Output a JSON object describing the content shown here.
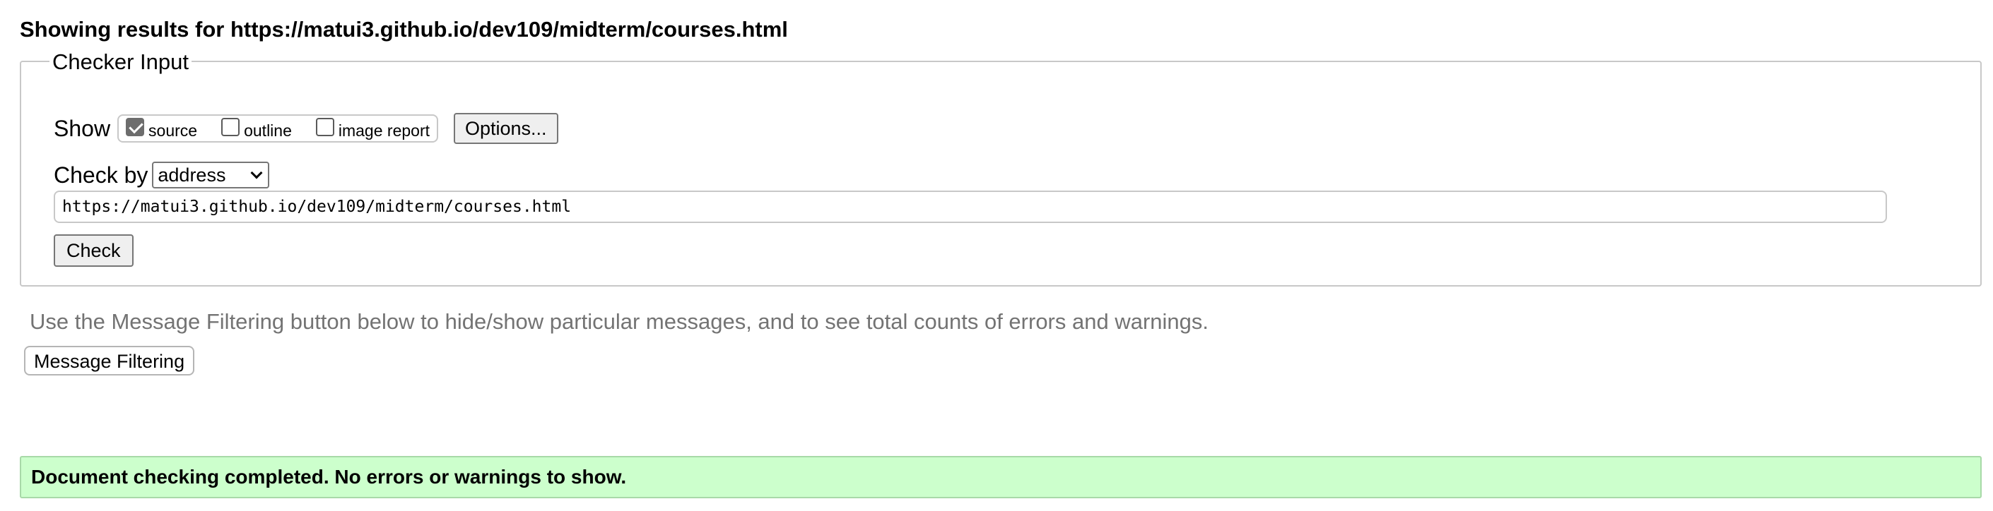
{
  "heading": "Showing results for https://matui3.github.io/dev109/midterm/courses.html",
  "checker": {
    "legend": "Checker Input",
    "show_label": "Show",
    "options": [
      {
        "label": "source",
        "checked": true
      },
      {
        "label": "outline",
        "checked": false
      },
      {
        "label": "image report",
        "checked": false
      }
    ],
    "options_button": "Options...",
    "check_by_label": "Check by",
    "check_by_value": "address",
    "url_value": "https://matui3.github.io/dev109/midterm/courses.html",
    "check_button": "Check"
  },
  "hint": "Use the Message Filtering button below to hide/show particular messages, and to see total counts of errors and warnings.",
  "filter_button": "Message Filtering",
  "status": "Document checking completed. No errors or warnings to show.",
  "colors": {
    "success_bg": "#ccffcc",
    "hint_text": "#737373"
  }
}
